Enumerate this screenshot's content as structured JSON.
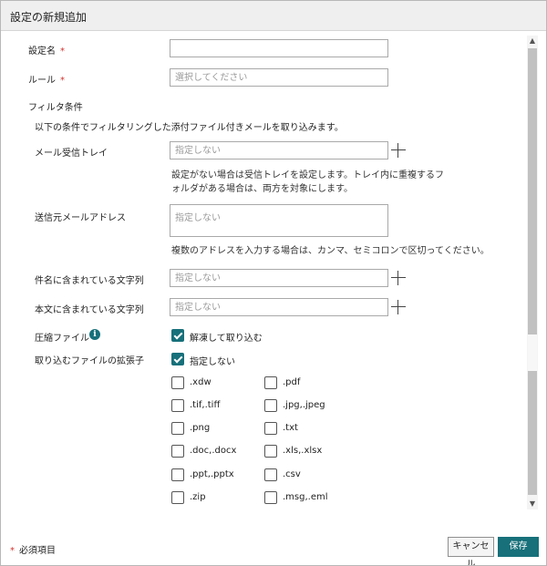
{
  "dialog": {
    "title": "設定の新規追加"
  },
  "form": {
    "setting_name": {
      "label": "設定名",
      "required_mark": "*",
      "value": ""
    },
    "rule": {
      "label": "ルール",
      "required_mark": "*",
      "placeholder": "選択してください"
    },
    "filter_section": {
      "title": "フィルタ条件",
      "description": "以下の条件でフィルタリングした添付ファイル付きメールを取り込みます。"
    },
    "mail_tray": {
      "label": "メール受信トレイ",
      "placeholder": "指定しない",
      "help_line1": "設定がない場合は受信トレイを設定します。トレイ内に重複するフ",
      "help_line2": "ォルダがある場合は、両方を対象にします。"
    },
    "sender": {
      "label": "送信元メールアドレス",
      "placeholder": "指定しない",
      "help": "複数のアドレスを入力する場合は、カンマ、セミコロンで区切ってください。"
    },
    "subject": {
      "label": "件名に含まれている文字列",
      "placeholder": "指定しない"
    },
    "body": {
      "label": "本文に含まれている文字列",
      "placeholder": "指定しない"
    },
    "compressed": {
      "label": "圧縮ファイル",
      "option": "解凍して取り込む",
      "checked": true
    },
    "extensions": {
      "label": "取り込むファイルの拡張子",
      "unspecified": "指定しない",
      "unspecified_checked": true,
      "left": [
        ".xdw",
        ".tif,.tiff",
        ".png",
        ".doc,.docx",
        ".ppt,.pptx",
        ".zip"
      ],
      "right": [
        ".pdf",
        ".jpg,.jpeg",
        ".txt",
        ".xls,.xlsx",
        ".csv",
        ".msg,.eml"
      ]
    }
  },
  "footer": {
    "required_mark": "*",
    "required_note": "必須項目"
  },
  "buttons": {
    "cancel": "キャンセル",
    "save": "保存"
  },
  "colors": {
    "accent": "#17707a",
    "required": "#d0332f"
  }
}
